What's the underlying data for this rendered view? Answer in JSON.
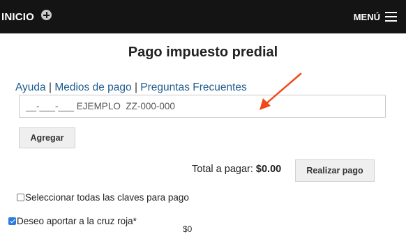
{
  "header": {
    "home_label": "INICIO",
    "menu_label": "MENÚ",
    "background_color": "#141414"
  },
  "page": {
    "title": "Pago impuesto predial"
  },
  "links": [
    {
      "label": "Ayuda"
    },
    {
      "label": "Medios de pago"
    },
    {
      "label": "Preguntas Frecuentes"
    }
  ],
  "links_separator": "|",
  "clave_input": {
    "value": "",
    "placeholder": "__-___-___ EJEMPLO  ZZ-000-000"
  },
  "buttons": {
    "agregar": "Agregar",
    "realizar_pago": "Realizar pago"
  },
  "total": {
    "label": "Total a pagar:",
    "amount": "$0.00"
  },
  "checkboxes": {
    "seleccionar_todas": {
      "label": "Seleccionar todas las claves para pago",
      "checked": false
    },
    "cruz_roja": {
      "label": "Deseo aportar a la cruz roja*",
      "checked": true
    }
  },
  "partial_text": "$0",
  "annotation": {
    "color": "#f04a1a"
  }
}
